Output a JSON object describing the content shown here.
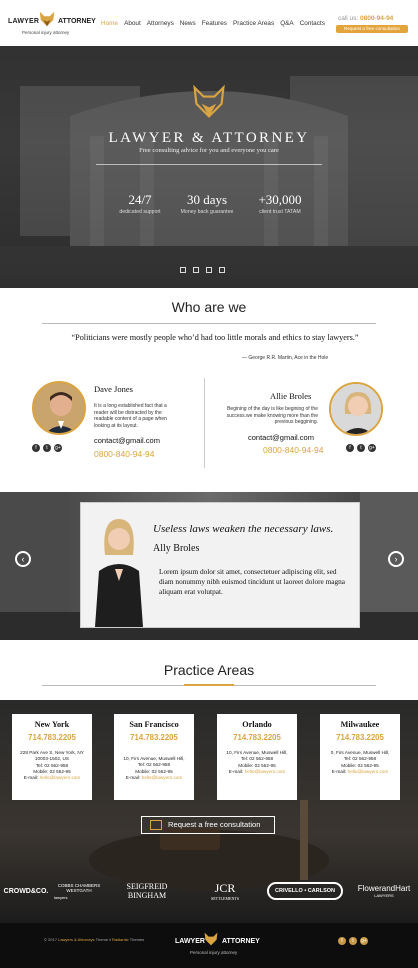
{
  "header": {
    "logo_left": "LAWYER",
    "logo_right": "ATTORNEY",
    "logo_tagline": "Personal injury attorney",
    "nav": [
      "Home",
      "About",
      "Attorneys",
      "News",
      "Features",
      "Practice Areas",
      "Q&A",
      "Contacts"
    ],
    "call_label": "call us:",
    "call_number": "0800-94-94",
    "request_button": "Request a free consultation"
  },
  "hero": {
    "title": "LAWYER & ATTORNEY",
    "subtitle": "Free consulting advice for you and everyone you care",
    "stats": [
      {
        "value": "24/7",
        "label": "dedicated support"
      },
      {
        "value": "30 days",
        "label": "Money back guarantee"
      },
      {
        "value": "+30,000",
        "label": "client trust TATAM"
      }
    ]
  },
  "who": {
    "title": "Who are we",
    "quote": "“Politicians were mostly people who’d had too little morals and ethics to stay lawyers.”",
    "quote_by": "— George R.R. Martin, Ace in the Hole",
    "people": [
      {
        "name": "Dave Jones",
        "text": "It is a long established fact that a reader will be distracted by the readable content of a page when looking at its layout.",
        "email": "contact@gmail.com",
        "phone": "0800-840-94-94"
      },
      {
        "name": "Allie Broles",
        "text": "Begining of the day is like begining of the success.we make knowing more than the previous beggining.",
        "email": "contact@gmail.com",
        "phone": "0800-840-94-94"
      }
    ],
    "social": [
      "f",
      "t",
      "g+"
    ]
  },
  "testimonial": {
    "quote": "Useless laws weaken the necessary laws.",
    "name": "Ally Broles",
    "body": "Lorem ipsum dolor sit amet, consectetuer adipiscing elit, sed diam nonummy nibh euismod tincidunt ut laoreet dolore magna aliquam erat volutpat."
  },
  "practice": {
    "title": "Practice Areas",
    "offices": [
      {
        "city": "New York",
        "tel": "714.783.2205",
        "lines": [
          "228 Park Ave S, New York, NY",
          "10003-1502, US",
          "Tel: 02 562-958",
          "Mobile: 02 562-95"
        ],
        "mail_label": "E-mail:",
        "mail": "hello@lawyers.com"
      },
      {
        "city": "San Francisco",
        "tel": "714.783.2205",
        "lines": [
          "10, Firs Avenue, Muswell Hill,",
          "Tel: 02 562-958",
          "Mobile: 02 562-95"
        ],
        "mail_label": "E-mail:",
        "mail": "hello@lawyers.com"
      },
      {
        "city": "Orlando",
        "tel": "714.783.2205",
        "lines": [
          "10, Firs Avenue, Muswell Hill,",
          "Tel: 02 562-958",
          "Mobile: 02 562-95"
        ],
        "mail_label": "E-mail:",
        "mail": "hello@lawyers.com"
      },
      {
        "city": "Milwaukee",
        "tel": "714.783.2205",
        "lines": [
          "0, Firs Avenue, Muswell Hill,",
          "Tel: 02 562-958",
          "Mobile: 02 562-95"
        ],
        "mail_label": "E-mail:",
        "mail": "hello@lawyers.com"
      }
    ],
    "consult_button": "Request a free consultation"
  },
  "partners": [
    {
      "name": "CROWD&CO.",
      "sub": ""
    },
    {
      "name": "COBBS CHAMBERS WESTGATH",
      "sub": "lawyers"
    },
    {
      "name": "SEIGFREID BINGHAM",
      "sub": ""
    },
    {
      "name": "JCR",
      "sub": "SETTLEMENTS"
    },
    {
      "name": "CRIVELLO • CARLSON",
      "sub": ""
    },
    {
      "name": "FlowerandHart",
      "sub": "LAWYERS"
    }
  ],
  "footer": {
    "copyright_pre": "© 2017",
    "copyright_brand": "Lawyers & Attorneys",
    "copyright_mid": "Theme ‖",
    "copyright_by": "Radiantic",
    "copyright_post": "Themes",
    "logo_left": "LAWYER",
    "logo_right": "ATTORNEY",
    "tagline": "Personal injury attorney",
    "social": [
      "f",
      "t",
      "g+"
    ]
  },
  "colors": {
    "accent": "#d9a441",
    "dark": "#1c1c1c"
  }
}
